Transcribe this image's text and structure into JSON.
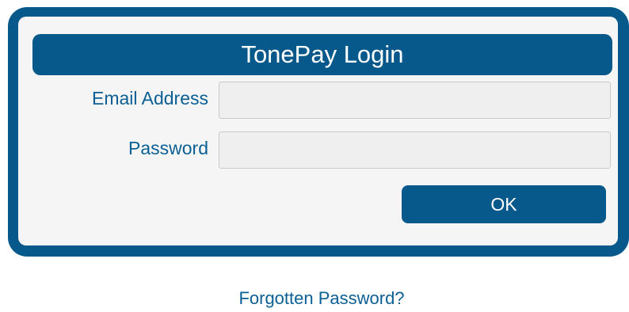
{
  "login": {
    "title": "TonePay Login",
    "email_label": "Email Address",
    "email_value": "",
    "password_label": "Password",
    "password_value": "",
    "ok_label": "OK"
  },
  "forgot_link": "Forgotten Password?",
  "colors": {
    "brand": "#08598b",
    "label": "#0c5f94",
    "panel": "#f5f5f5",
    "field": "#efefef"
  }
}
